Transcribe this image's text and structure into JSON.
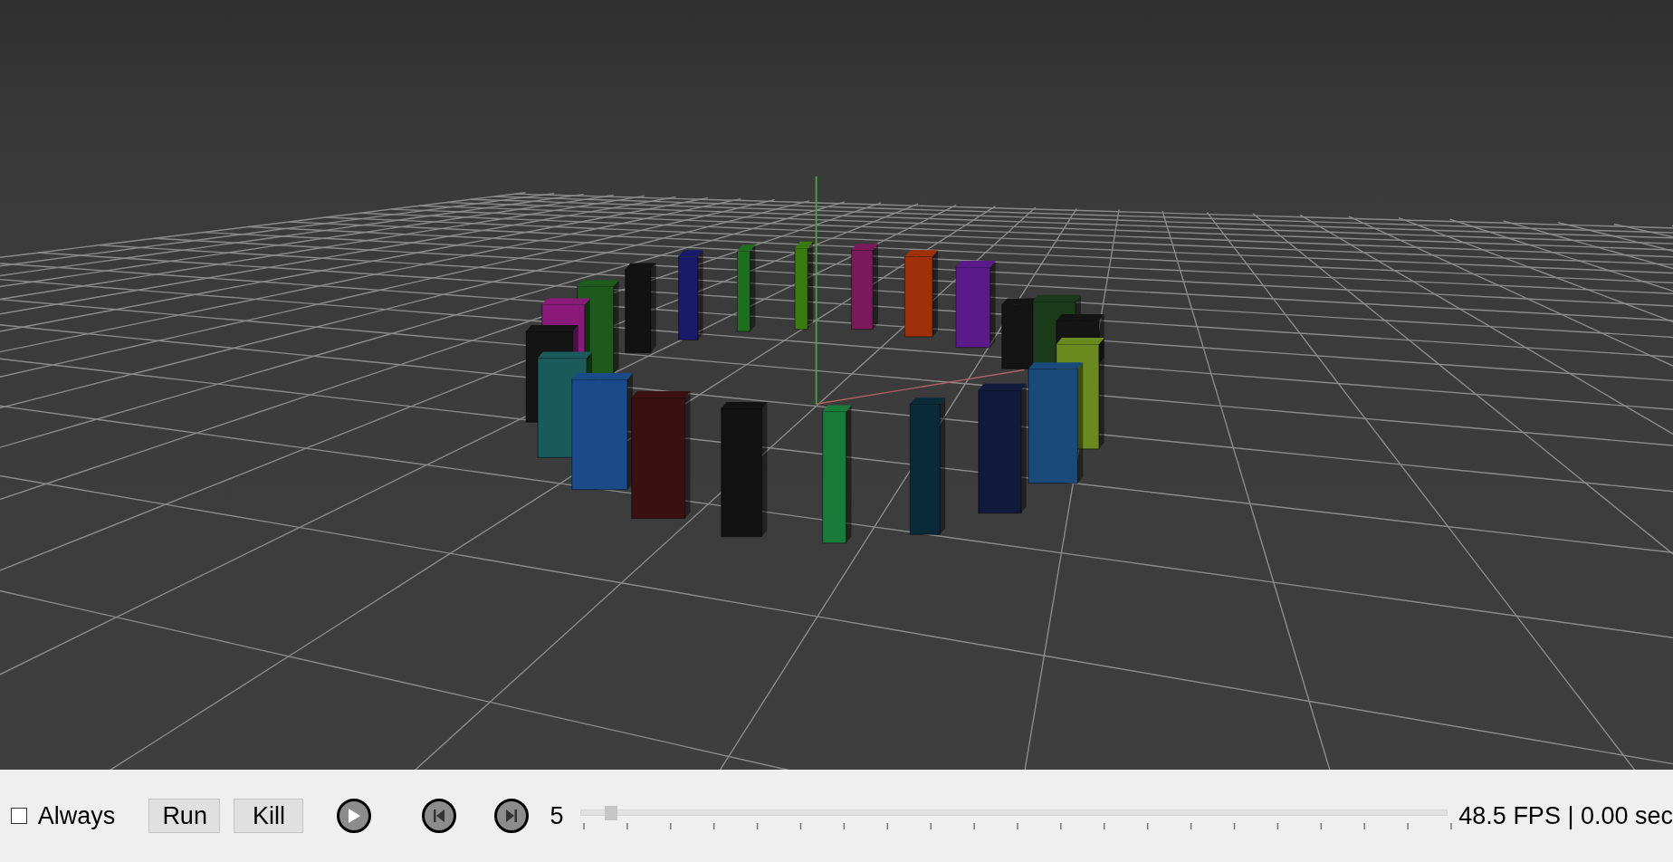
{
  "toolbar": {
    "always": {
      "label": "Always",
      "checked": false
    },
    "buttons": [
      {
        "kind": "text",
        "label": "Run"
      },
      {
        "kind": "text",
        "label": "Kill"
      },
      {
        "kind": "play"
      },
      {
        "kind": "step-back"
      },
      {
        "kind": "step-forward"
      }
    ],
    "frame_slider": {
      "value": "5",
      "level": 0.035
    },
    "status": "48.5 FPS | 0.00 sec"
  }
}
